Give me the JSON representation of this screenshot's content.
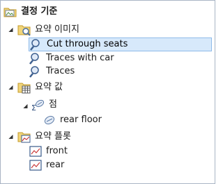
{
  "tree": {
    "root": {
      "label": "결정 기준",
      "icon": "folder-icon"
    },
    "groups": [
      {
        "label": "요약 이미지",
        "icon": "image-folder-icon",
        "items": [
          {
            "label": "Cut through seats",
            "icon": "image-search-icon",
            "selected": true
          },
          {
            "label": "Traces with car",
            "icon": "image-search-icon"
          },
          {
            "label": "Traces",
            "icon": "image-search-icon"
          }
        ]
      },
      {
        "label": "요약 값",
        "icon": "table-folder-icon",
        "items": [
          {
            "label": "점",
            "icon": "sum-point-icon",
            "children": [
              {
                "label": "rear floor",
                "icon": "point-icon"
              }
            ]
          }
        ]
      },
      {
        "label": "요약 플롯",
        "icon": "plot-folder-icon",
        "items": [
          {
            "label": "front",
            "icon": "plot-icon"
          },
          {
            "label": "rear",
            "icon": "plot-icon"
          }
        ]
      }
    ]
  }
}
